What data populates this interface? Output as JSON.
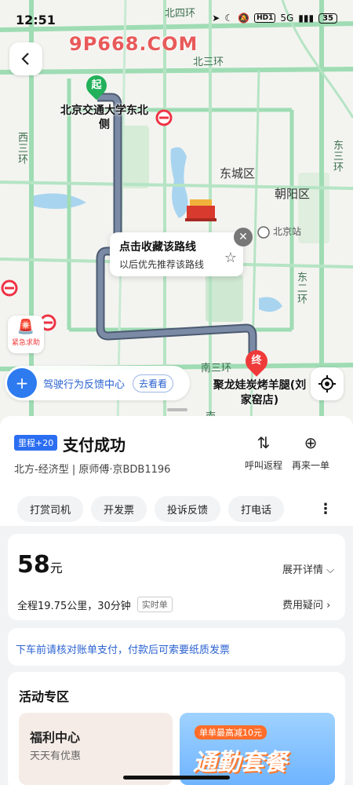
{
  "status_bar": {
    "time": "12:51",
    "hd": "HD1",
    "net": "5G",
    "battery": "35"
  },
  "watermark": "9P668.COM",
  "map": {
    "labels": {
      "beisihuan": "北四环",
      "beisanhuan": "北三环",
      "dongcheng": "东城区",
      "chaoyang": "朝阳区",
      "beijingzhan": "北京站",
      "xisanhuan": "西三环",
      "dongsanhuan": "东三环",
      "dongerhuan": "东二环",
      "nansanhuan": "南三环",
      "nan": "南"
    },
    "start": {
      "badge": "起",
      "label": "北京交通大学东北侧"
    },
    "end": {
      "badge": "终",
      "label": "聚龙娃炭烤羊腿(刘家窑店)"
    },
    "fav_bubble": {
      "title": "点击收藏该路线",
      "subtitle": "以后优先推荐该路线"
    },
    "sos_label": "紧急求助",
    "feedback": {
      "text": "驾驶行为反馈中心",
      "button": "去看看"
    }
  },
  "trip": {
    "mile_badge": "里程+20",
    "status_title": "支付成功",
    "car_info": "北方-经济型 | 原师傅·京BDB1196",
    "actions": [
      {
        "label": "呼叫返程",
        "icon": "return-icon"
      },
      {
        "label": "再来一单",
        "icon": "reorder-icon"
      }
    ],
    "chips": [
      "打赏司机",
      "开发票",
      "投诉反馈",
      "打电话"
    ]
  },
  "fare": {
    "amount": "58",
    "unit": "元",
    "expand_label": "展开详情",
    "trip_summary": "全程19.75公里，30分钟",
    "realtime_tag": "实时单",
    "fee_question": "费用疑问"
  },
  "notice": "下车前请核对账单支付，付款后可索要纸质发票",
  "promo": {
    "title": "活动专区",
    "welfare": {
      "title": "福利中心",
      "subtitle": "天天有优惠"
    },
    "commute": {
      "tag": "单单最高减10元",
      "title": "通勤套餐"
    }
  }
}
